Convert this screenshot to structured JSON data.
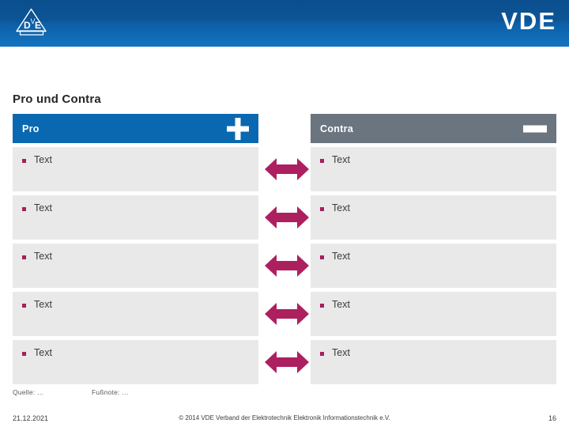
{
  "banner": {
    "logo_icon": "vde-triangle-logo-icon",
    "logo_letters": [
      "D",
      "V",
      "E"
    ],
    "wordmark": "VDE",
    "gradient_top": "#0b4e8e",
    "gradient_bottom": "#1272bf"
  },
  "slide": {
    "title": "Pro und Contra"
  },
  "columns": [
    {
      "key": "pro",
      "header_label": "Pro",
      "header_color": "#0a68b0",
      "header_icon": "plus-icon",
      "rows": [
        {
          "text": "Text"
        },
        {
          "text": "Text"
        },
        {
          "text": "Text"
        },
        {
          "text": "Text"
        },
        {
          "text": "Text"
        }
      ]
    },
    {
      "key": "contra",
      "header_label": "Contra",
      "header_color": "#6b7580",
      "header_icon": "minus-icon",
      "rows": [
        {
          "text": "Text"
        },
        {
          "text": "Text"
        },
        {
          "text": "Text"
        },
        {
          "text": "Text"
        },
        {
          "text": "Text"
        }
      ]
    }
  ],
  "arrows": {
    "icon": "double-headed-arrow-icon",
    "color": "#ad2060",
    "count": 5
  },
  "bullet_color": "#a3205a",
  "row_background": "#e9e9e9",
  "footer": {
    "quelle": "Quelle: …",
    "fussnote": "Fußnote: …",
    "date": "21.12.2021",
    "copyright": "© 2014 VDE Verband der Elektrotechnik Elektronik Informationstechnik e.V.",
    "page_number": "16"
  }
}
